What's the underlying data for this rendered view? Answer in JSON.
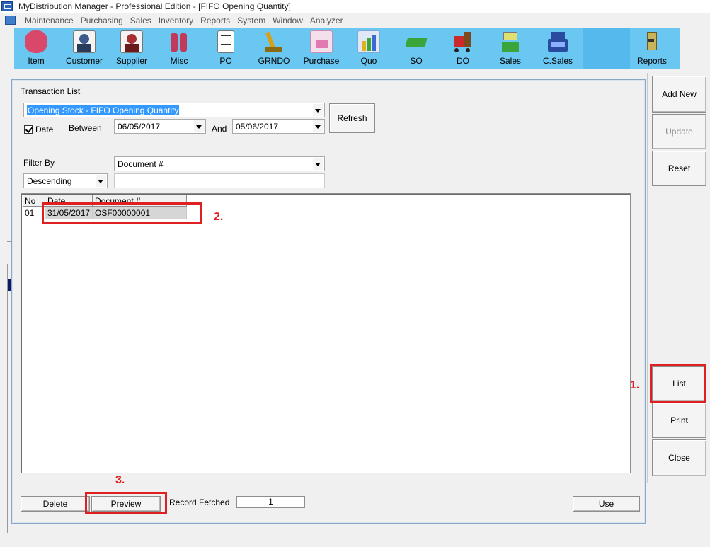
{
  "window": {
    "title": "MyDistribution Manager - Professional Edition - [FIFO Opening Quantity]"
  },
  "menu": {
    "items": [
      "Maintenance",
      "Purchasing",
      "Sales",
      "Inventory",
      "Reports",
      "System",
      "Window",
      "Analyzer"
    ]
  },
  "toolbar": {
    "tools": [
      {
        "label": "Item",
        "icon": "item-icon",
        "color": "#d9476a"
      },
      {
        "label": "Customer",
        "icon": "customer-icon",
        "color": "#3d5a8a"
      },
      {
        "label": "Supplier",
        "icon": "supplier-icon",
        "color": "#a63030"
      },
      {
        "label": "Misc",
        "icon": "misc-icon",
        "color": "#c23a5a"
      },
      {
        "label": "PO",
        "icon": "po-icon",
        "color": "#ffffff"
      },
      {
        "label": "GRNDO",
        "icon": "grndo-icon",
        "color": "#d4a017"
      },
      {
        "label": "Purchase",
        "icon": "purchase-icon",
        "color": "#e07ab0"
      },
      {
        "label": "Quo",
        "icon": "quo-icon",
        "color": "#7fa9d8"
      },
      {
        "label": "SO",
        "icon": "so-icon",
        "color": "#3aa53a"
      },
      {
        "label": "DO",
        "icon": "do-icon",
        "color": "#cc2a2a"
      },
      {
        "label": "Sales",
        "icon": "sales-icon",
        "color": "#3aa53a"
      },
      {
        "label": "C.Sales",
        "icon": "csales-icon",
        "color": "#2a4aa0"
      }
    ],
    "reports": {
      "label": "Reports",
      "icon": "reports-icon",
      "color": "#8a7a3a"
    }
  },
  "dialog": {
    "title": "Transaction List",
    "transaction_type": "Opening Stock - FIFO Opening Quantity",
    "date_check_label": "Date",
    "between_label": "Between",
    "date_from": "06/05/2017",
    "and_label": "And",
    "date_to": "05/06/2017",
    "refresh_label": "Refresh",
    "filter_by_label": "Filter By",
    "filter_field": "Document #",
    "sort_order": "Descending",
    "filter_value": "",
    "grid": {
      "columns": [
        "No",
        "Date",
        "Document #"
      ],
      "rows": [
        {
          "no": "01",
          "date": "31/05/2017",
          "document": "OSF00000001"
        }
      ]
    },
    "delete_label": "Delete",
    "preview_label": "Preview",
    "record_fetched_label": "Record Fetched",
    "record_fetched_value": "1",
    "use_label": "Use"
  },
  "sidepanel": {
    "add_new_label": "Add New",
    "update_label": "Update",
    "reset_label": "Reset",
    "list_label": "List",
    "print_label": "Print",
    "close_label": "Close"
  },
  "annotations": {
    "step1": "1.",
    "step2": "2.",
    "step3": "3."
  },
  "colors": {
    "toolbar_bg": "#6ac7f2",
    "highlight_red": "#e02020",
    "selection_blue": "#3399ff"
  }
}
